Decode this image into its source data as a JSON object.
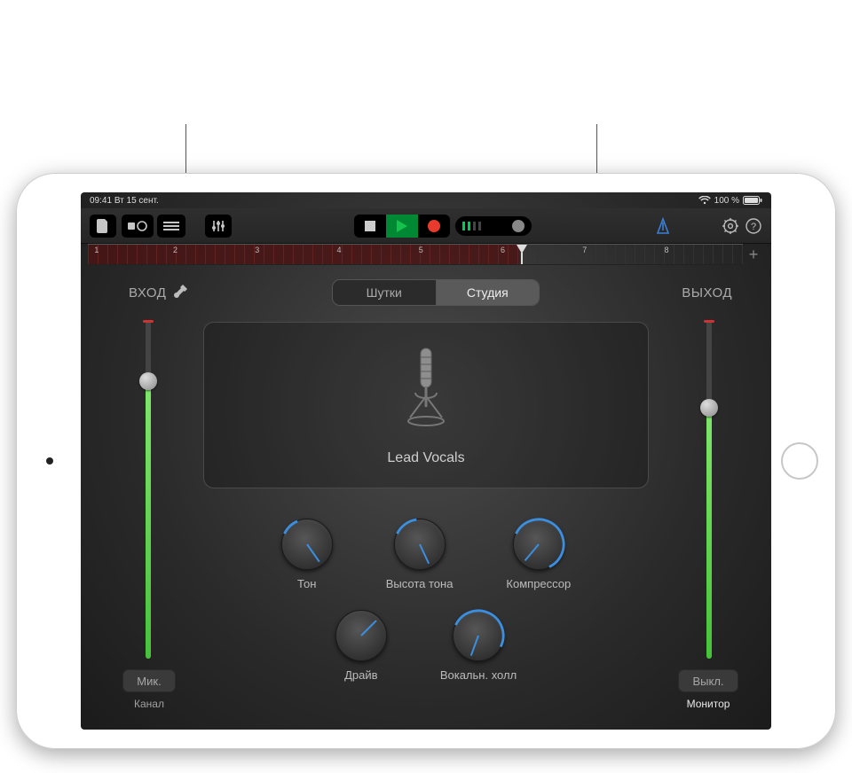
{
  "status": {
    "time": "09:41",
    "date": "Вт 15 сент.",
    "battery_pct": "100 %",
    "wifi": true
  },
  "ruler": {
    "bars": [
      "1",
      "2",
      "3",
      "4",
      "5",
      "6",
      "7",
      "8"
    ],
    "playhead_bar": 6,
    "region_end_bar": 6
  },
  "io": {
    "in_label": "ВХОД",
    "out_label": "ВЫХОД"
  },
  "tabs": {
    "fun": "Шутки",
    "studio": "Студия",
    "active": "studio"
  },
  "preset": {
    "name": "Lead Vocals"
  },
  "sliders": {
    "input": {
      "value_pct": 82,
      "peak": true
    },
    "output": {
      "value_pct": 74,
      "peak": true
    }
  },
  "knobs": {
    "row1": [
      {
        "id": "tone",
        "label": "Тон",
        "angle_deg": 325,
        "arc_pct": 12
      },
      {
        "id": "pitch",
        "label": "Высота тона",
        "angle_deg": 335,
        "arc_pct": 18
      },
      {
        "id": "compressor",
        "label": "Компрессор",
        "angle_deg": 40,
        "arc_pct": 62
      }
    ],
    "row2": [
      {
        "id": "drive",
        "label": "Драйв",
        "angle_deg": 225,
        "arc_pct": 0
      },
      {
        "id": "vocal-hall",
        "label": "Вокальн. холл",
        "angle_deg": 20,
        "arc_pct": 50
      }
    ]
  },
  "footer": {
    "mic_chip": "Мик.",
    "channel_label": "Канал",
    "off_chip": "Выкл.",
    "monitor_label": "Монитор"
  },
  "icons": {
    "plug": "plug-icon",
    "plus": "+"
  }
}
